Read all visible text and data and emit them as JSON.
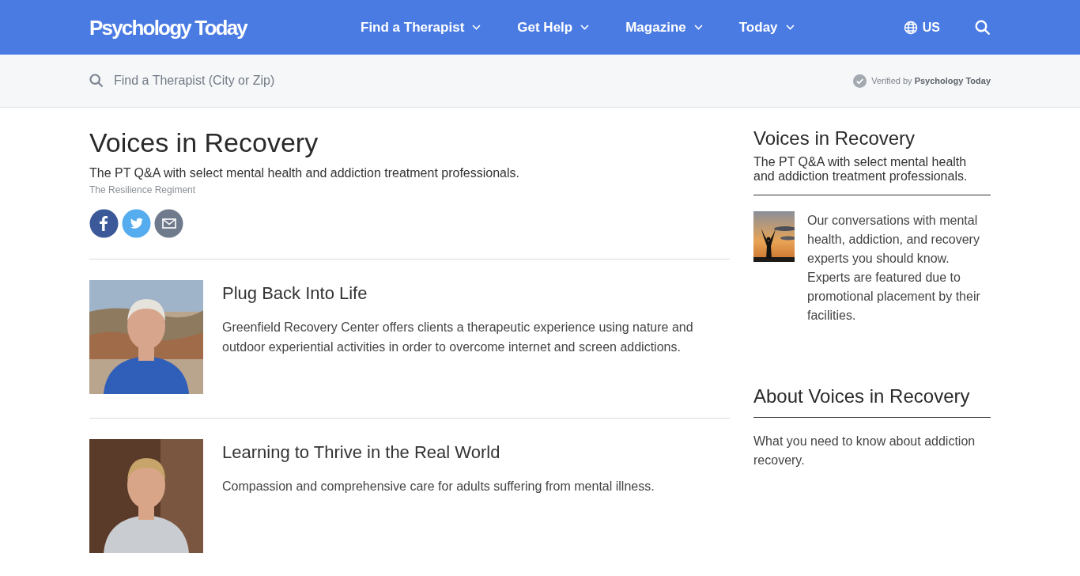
{
  "header": {
    "logo": "Psychology Today",
    "nav": [
      {
        "label": "Find a Therapist"
      },
      {
        "label": "Get Help"
      },
      {
        "label": "Magazine"
      },
      {
        "label": "Today"
      }
    ],
    "region": "US"
  },
  "search_bar": {
    "placeholder": "Find a Therapist (City or Zip)",
    "verified_prefix": "Verified by",
    "verified_brand": "Psychology Today"
  },
  "main": {
    "title": "Voices in Recovery",
    "subtitle": "The PT Q&A with select mental health and addiction treatment professionals.",
    "byline": "The Resilience Regiment",
    "share": [
      {
        "kind": "facebook"
      },
      {
        "kind": "twitter"
      },
      {
        "kind": "email"
      }
    ],
    "articles": [
      {
        "title": "Plug Back Into Life",
        "summary": "Greenfield Recovery Center offers clients a therapeutic experience using nature and outdoor experiential activities in order to overcome internet and screen addictions."
      },
      {
        "title": "Learning to Thrive in the Real World",
        "summary": "Compassion and comprehensive care for adults suffering from mental illness."
      }
    ]
  },
  "sidebar": {
    "title": "Voices in Recovery",
    "subtitle": "The PT Q&A with select mental health and addiction treatment professionals.",
    "blurb": "Our conversations with mental health, addiction, and recovery experts you should know. Experts are featured due to promotional placement by their facilities.",
    "about_title": "About Voices in Recovery",
    "about_text": "What you need to know about addiction recovery."
  }
}
